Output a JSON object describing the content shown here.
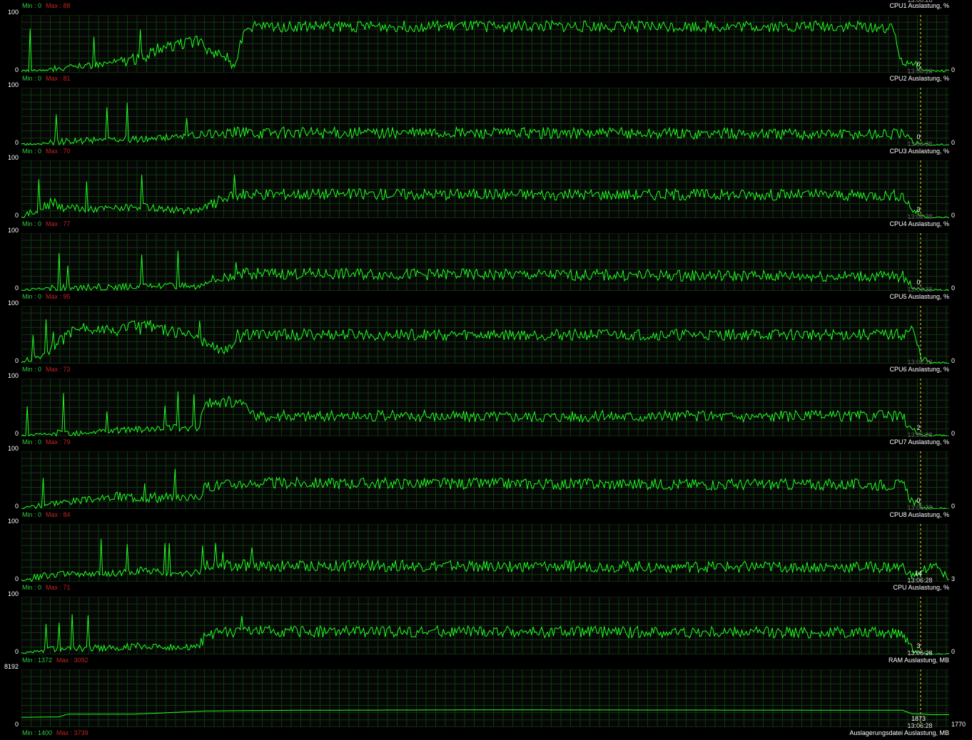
{
  "header": {
    "timestamp": "13:06:28"
  },
  "colors": {
    "background": "#000000",
    "grid": "#0c3a0c",
    "line": "#22ff22",
    "min": "#2ecc40",
    "max": "#c0261e",
    "cursor": "#e8e020"
  },
  "panels": [
    {
      "title": "CPU1 Auslastung, %",
      "min_label": "Min : 0",
      "max_label": "Max : 88",
      "y_max": "100",
      "y_min": "0",
      "snapshot_value": "6",
      "snapshot_time": "13:06:28",
      "current_value": "0"
    },
    {
      "title": "CPU2 Auslastung, %",
      "min_label": "Min : 0",
      "max_label": "Max : 81",
      "y_max": "100",
      "y_min": "0",
      "snapshot_value": "0",
      "snapshot_time": "13:06:28",
      "current_value": "0"
    },
    {
      "title": "CPU3 Auslastung, %",
      "min_label": "Min : 0",
      "max_label": "Max : 70",
      "y_max": "100",
      "y_min": "0",
      "snapshot_value": "3",
      "snapshot_time": "13:06:28",
      "current_value": "0"
    },
    {
      "title": "CPU4 Auslastung, %",
      "min_label": "Min : 0",
      "max_label": "Max : 77",
      "y_max": "100",
      "y_min": "0",
      "snapshot_value": "0",
      "snapshot_time": "13:06:28",
      "current_value": "0"
    },
    {
      "title": "CPU5 Auslastung, %",
      "min_label": "Min : 0",
      "max_label": "Max : 95",
      "y_max": "100",
      "y_min": "0",
      "snapshot_value": "",
      "snapshot_time": "13:06:28",
      "current_value": "0"
    },
    {
      "title": "CPU6 Auslastung, %",
      "min_label": "Min : 0",
      "max_label": "Max : 73",
      "y_max": "100",
      "y_min": "0",
      "snapshot_value": "2",
      "snapshot_time": "13:06:28",
      "current_value": "0"
    },
    {
      "title": "CPU7 Auslastung, %",
      "min_label": "Min : 0",
      "max_label": "Max : 79",
      "y_max": "100",
      "y_min": "0",
      "snapshot_value": "0",
      "snapshot_time": "13:06:28",
      "current_value": "0"
    },
    {
      "title": "CPU8 Auslastung, %",
      "min_label": "Min : 0",
      "max_label": "Max : 84",
      "y_max": "100",
      "y_min": "0",
      "snapshot_value": "14",
      "snapshot_time": "13:06:28",
      "current_value": "3"
    },
    {
      "title": "CPU Auslastung, %",
      "min_label": "Min : 0",
      "max_label": "Max : 71",
      "y_max": "100",
      "y_min": "0",
      "snapshot_value": "3",
      "snapshot_time": "13:06:28",
      "current_value": "0"
    },
    {
      "title": "RAM Auslastung, MB",
      "min_label": "Min : 1372",
      "max_label": "Max : 3092",
      "y_max": "8192",
      "y_min": "0",
      "snapshot_value": "1873",
      "snapshot_time": "13:06:28",
      "current_value": "1770"
    }
  ],
  "footer": {
    "title": "Auslagerungsdatei Auslastung, MB",
    "min_label": "Min : 1400",
    "max_label": "Max : 3739"
  },
  "chart_data": [
    {
      "type": "line",
      "title": "CPU1 Auslastung, %",
      "ylim": [
        0,
        100
      ],
      "profile": [
        [
          0,
          3
        ],
        [
          3,
          5
        ],
        [
          7,
          12
        ],
        [
          13,
          25
        ],
        [
          16,
          45
        ],
        [
          19,
          55
        ],
        [
          20,
          40
        ],
        [
          22,
          30
        ],
        [
          23,
          5
        ],
        [
          24,
          80
        ],
        [
          92,
          80
        ],
        [
          94,
          75
        ],
        [
          95,
          15
        ],
        [
          96,
          20
        ],
        [
          97,
          5
        ],
        [
          98,
          3
        ],
        [
          100,
          3
        ]
      ]
    },
    {
      "type": "line",
      "title": "CPU2 Auslastung, %",
      "ylim": [
        0,
        100
      ],
      "profile": [
        [
          0,
          1
        ],
        [
          3,
          5
        ],
        [
          10,
          12
        ],
        [
          13,
          10
        ],
        [
          17,
          15
        ],
        [
          20,
          20
        ],
        [
          22,
          22
        ],
        [
          24,
          22
        ],
        [
          95,
          20
        ],
        [
          96,
          8
        ],
        [
          97,
          3
        ],
        [
          98,
          1
        ],
        [
          100,
          1
        ]
      ]
    },
    {
      "type": "line",
      "title": "CPU3 Auslastung, %",
      "ylim": [
        0,
        100
      ],
      "profile": [
        [
          0,
          1
        ],
        [
          3,
          25
        ],
        [
          7,
          15
        ],
        [
          13,
          20
        ],
        [
          16,
          15
        ],
        [
          19,
          12
        ],
        [
          20,
          20
        ],
        [
          22,
          35
        ],
        [
          24,
          42
        ],
        [
          95,
          40
        ],
        [
          96,
          15
        ],
        [
          97,
          5
        ],
        [
          98,
          1
        ],
        [
          100,
          1
        ]
      ]
    },
    {
      "type": "line",
      "title": "CPU4 Auslastung, %",
      "ylim": [
        0,
        100
      ],
      "profile": [
        [
          0,
          1
        ],
        [
          3,
          5
        ],
        [
          13,
          8
        ],
        [
          16,
          10
        ],
        [
          19,
          8
        ],
        [
          20,
          18
        ],
        [
          22,
          25
        ],
        [
          24,
          30
        ],
        [
          95,
          25
        ],
        [
          96,
          8
        ],
        [
          97,
          3
        ],
        [
          98,
          1
        ],
        [
          100,
          1
        ]
      ]
    },
    {
      "type": "line",
      "title": "CPU5 Auslastung, %",
      "ylim": [
        0,
        100
      ],
      "profile": [
        [
          0,
          2
        ],
        [
          3,
          20
        ],
        [
          6,
          65
        ],
        [
          10,
          55
        ],
        [
          13,
          70
        ],
        [
          16,
          55
        ],
        [
          19,
          50
        ],
        [
          20,
          30
        ],
        [
          22,
          25
        ],
        [
          24,
          50
        ],
        [
          95,
          50
        ],
        [
          96,
          60
        ],
        [
          97,
          10
        ],
        [
          98,
          1
        ],
        [
          100,
          1
        ]
      ]
    },
    {
      "type": "line",
      "title": "CPU6 Auslastung, %",
      "ylim": [
        0,
        100
      ],
      "profile": [
        [
          0,
          1
        ],
        [
          3,
          5
        ],
        [
          13,
          12
        ],
        [
          16,
          15
        ],
        [
          19,
          15
        ],
        [
          20,
          60
        ],
        [
          24,
          60
        ],
        [
          25,
          35
        ],
        [
          95,
          35
        ],
        [
          96,
          10
        ],
        [
          97,
          3
        ],
        [
          98,
          1
        ],
        [
          100,
          1
        ]
      ]
    },
    {
      "type": "line",
      "title": "CPU7 Auslastung, %",
      "ylim": [
        0,
        100
      ],
      "profile": [
        [
          0,
          2
        ],
        [
          3,
          10
        ],
        [
          10,
          20
        ],
        [
          13,
          22
        ],
        [
          16,
          20
        ],
        [
          19,
          20
        ],
        [
          20,
          40
        ],
        [
          22,
          42
        ],
        [
          24,
          45
        ],
        [
          95,
          42
        ],
        [
          96,
          15
        ],
        [
          97,
          3
        ],
        [
          98,
          1
        ],
        [
          100,
          1
        ]
      ]
    },
    {
      "type": "line",
      "title": "CPU8 Auslastung, %",
      "ylim": [
        0,
        100
      ],
      "profile": [
        [
          0,
          2
        ],
        [
          3,
          12
        ],
        [
          10,
          15
        ],
        [
          13,
          20
        ],
        [
          16,
          15
        ],
        [
          19,
          15
        ],
        [
          20,
          30
        ],
        [
          24,
          28
        ],
        [
          95,
          25
        ],
        [
          96,
          10
        ],
        [
          97,
          15
        ],
        [
          98,
          30
        ],
        [
          99,
          20
        ],
        [
          100,
          5
        ]
      ]
    },
    {
      "type": "line",
      "title": "CPU Auslastung, %",
      "ylim": [
        0,
        100
      ],
      "profile": [
        [
          0,
          2
        ],
        [
          3,
          10
        ],
        [
          10,
          12
        ],
        [
          13,
          15
        ],
        [
          16,
          12
        ],
        [
          19,
          12
        ],
        [
          20,
          35
        ],
        [
          24,
          40
        ],
        [
          95,
          38
        ],
        [
          96,
          10
        ],
        [
          97,
          3
        ],
        [
          98,
          1
        ],
        [
          100,
          1
        ]
      ]
    },
    {
      "type": "line",
      "title": "RAM Auslastung, MB",
      "ylim": [
        0,
        8192
      ],
      "profile": [
        [
          0,
          1400
        ],
        [
          4,
          1450
        ],
        [
          5,
          1850
        ],
        [
          12,
          1850
        ],
        [
          14,
          1950
        ],
        [
          20,
          2300
        ],
        [
          30,
          2400
        ],
        [
          50,
          2450
        ],
        [
          95,
          2400
        ],
        [
          96,
          1880
        ],
        [
          97,
          1873
        ],
        [
          98,
          1770
        ],
        [
          100,
          1770
        ]
      ]
    }
  ]
}
